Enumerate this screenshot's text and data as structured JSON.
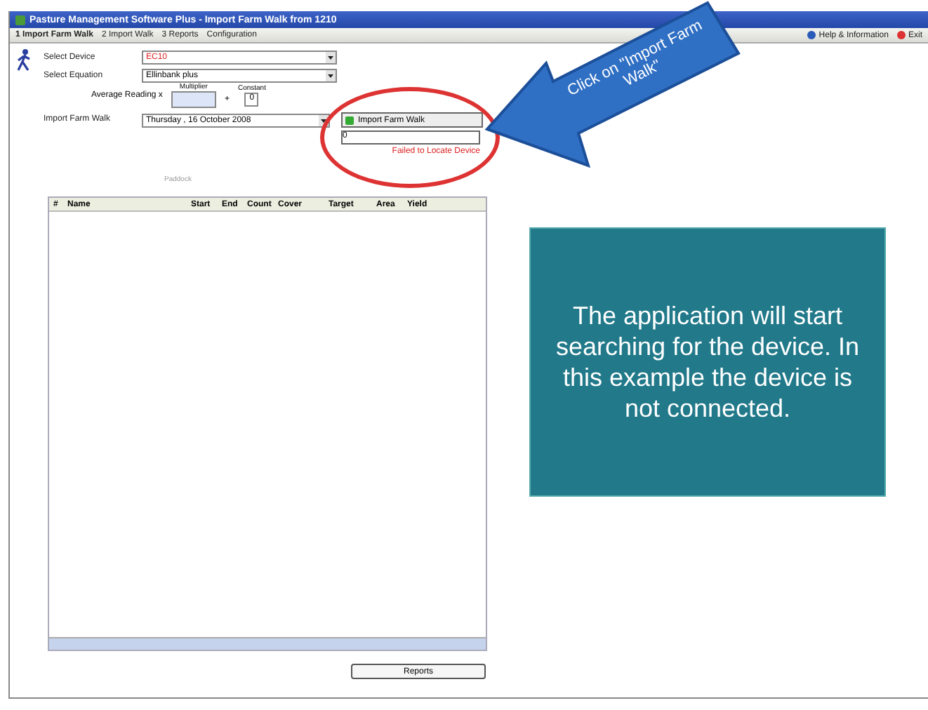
{
  "window": {
    "title": "Pasture Management Software Plus - Import Farm Walk from 1210"
  },
  "toolbar": {
    "items": [
      {
        "label": "1 Import Farm Walk",
        "selected": true
      },
      {
        "label": "2 Import Walk",
        "selected": false
      },
      {
        "label": "3 Reports",
        "selected": false
      },
      {
        "label": "Configuration",
        "selected": false
      }
    ],
    "right_items": [
      {
        "label": "Help & Information",
        "kind": "help"
      },
      {
        "label": "Exit",
        "kind": "exit"
      }
    ]
  },
  "form": {
    "select_device": {
      "label": "Select Device",
      "value": "EC10"
    },
    "select_equation": {
      "label": "Select Equation",
      "value": "Ellinbank plus"
    },
    "average_reading": {
      "label": "Average Reading x",
      "multiplier_label": "Multiplier",
      "plus_sign": "+",
      "constant_label": "Constant",
      "constant_value": "0"
    },
    "import_farm_walk": {
      "label": "Import Farm Walk",
      "date": "Thursday , 16 October 2008",
      "button": "Import Farm Walk",
      "status_field": "0",
      "status_message": "Failed to Locate Device"
    }
  },
  "table": {
    "group_label": "Paddock",
    "columns": [
      "#",
      "Name",
      "Start",
      "End",
      "Count",
      "Cover",
      "Target",
      "Area",
      "Yield"
    ]
  },
  "reports_button": {
    "label": "Reports"
  },
  "callout": {
    "text": "Click on \"Import Farm Walk\""
  },
  "info_box": {
    "text": "The application will start searching for the device. In this example the device is not connected."
  }
}
